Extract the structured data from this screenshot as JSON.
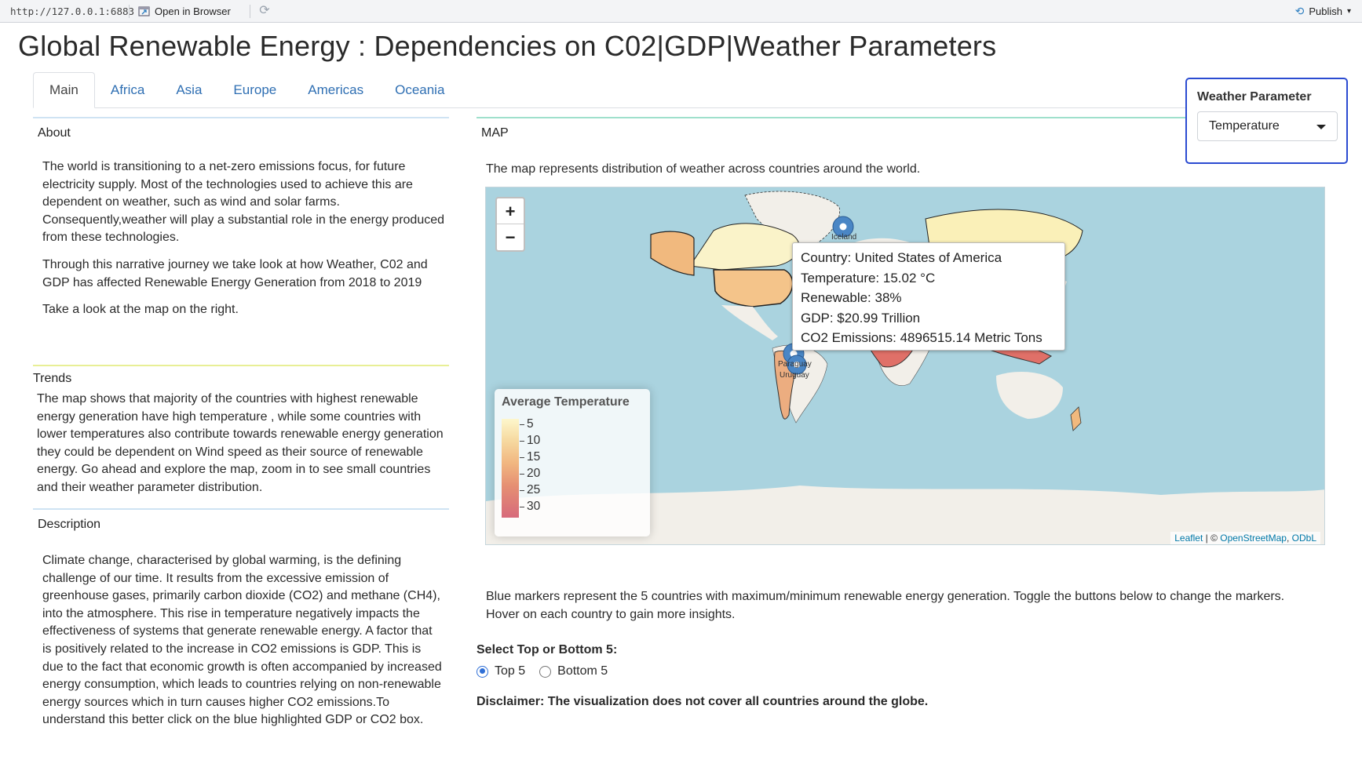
{
  "toolbar": {
    "url": "http://127.0.0.1:6883",
    "open_in_browser": "Open in Browser",
    "publish": "Publish"
  },
  "page_title": "Global Renewable Energy : Dependencies on C02|GDP|Weather Parameters",
  "tabs": [
    {
      "label": "Main",
      "active": true
    },
    {
      "label": "Africa"
    },
    {
      "label": "Asia"
    },
    {
      "label": "Europe"
    },
    {
      "label": "Americas"
    },
    {
      "label": "Oceania"
    }
  ],
  "weather_parameter": {
    "label": "Weather Parameter",
    "selected": "Temperature"
  },
  "about": {
    "heading": "About",
    "paragraphs": [
      "The world is transitioning to a net-zero emissions focus, for future electricity supply. Most of the technologies used to achieve this are dependent on weather, such as wind and solar farms. Consequently,weather will play a substantial role in the energy produced from these technologies.",
      "Through this narrative journey we take look at how Weather, C02 and GDP has affected Renewable Energy Generation from 2018 to 2019",
      "Take a look at the map on the right."
    ]
  },
  "trends": {
    "heading": "Trends",
    "text": "The map shows that majority of the countries with highest renewable energy generation have high temperature , while some countries with lower temperatures also contribute towards renewable energy generation they could be dependent on Wind speed as their source of renewable energy. Go ahead and explore the map, zoom in to see small countries and their weather parameter distribution."
  },
  "description": {
    "heading": "Description",
    "text": "Climate change, characterised by global warming, is the defining challenge of our time. It results from the excessive emission of greenhouse gases, primarily carbon dioxide (CO2) and methane (CH4), into the atmosphere. This rise in temperature negatively impacts the effectiveness of systems that generate renewable energy. A factor that is positively related to the increase in CO2 emissions is GDP. This is due to the fact that economic growth is often accompanied by increased energy consumption, which leads to countries relying on non-renewable energy sources which in turn causes higher CO2 emissions.To understand this better click on the blue highlighted GDP or CO2 box."
  },
  "map": {
    "heading": "MAP",
    "intro": "The map represents distribution of weather across countries around the world.",
    "zoom_in": "+",
    "zoom_out": "−",
    "tooltip": {
      "country": "Country: United States of America",
      "temperature": "Temperature: 15.02 °C",
      "renewable": "Renewable: 38%",
      "gdp": "GDP: $20.99 Trillion",
      "co2": "CO2 Emissions: 4896515.14 Metric Tons"
    },
    "legend": {
      "title": "Average Temperature",
      "ticks": [
        "5",
        "10",
        "15",
        "20",
        "25",
        "30"
      ]
    },
    "markers": [
      "Iceland",
      "Paraguay",
      "Uruguay"
    ],
    "attribution": {
      "leaflet": "Leaflet",
      "middle": " | © ",
      "osm": "OpenStreetMap",
      "sep": ", ",
      "odbl": "ODbL"
    },
    "note": "Blue markers represent the 5 countries with maximum/minimum renewable energy generation. Toggle the buttons below to change the markers. Hover on each country to gain more insights.",
    "colors": {
      "water": "#aad3df",
      "land": "#f2efe9",
      "marker": "#4a86c5"
    }
  },
  "top_bottom": {
    "label": "Select Top or Bottom 5:",
    "options": [
      "Top 5",
      "Bottom 5"
    ],
    "selected": "Top 5"
  },
  "disclaimer": "Disclaimer: The visualization does not cover all countries around the globe."
}
